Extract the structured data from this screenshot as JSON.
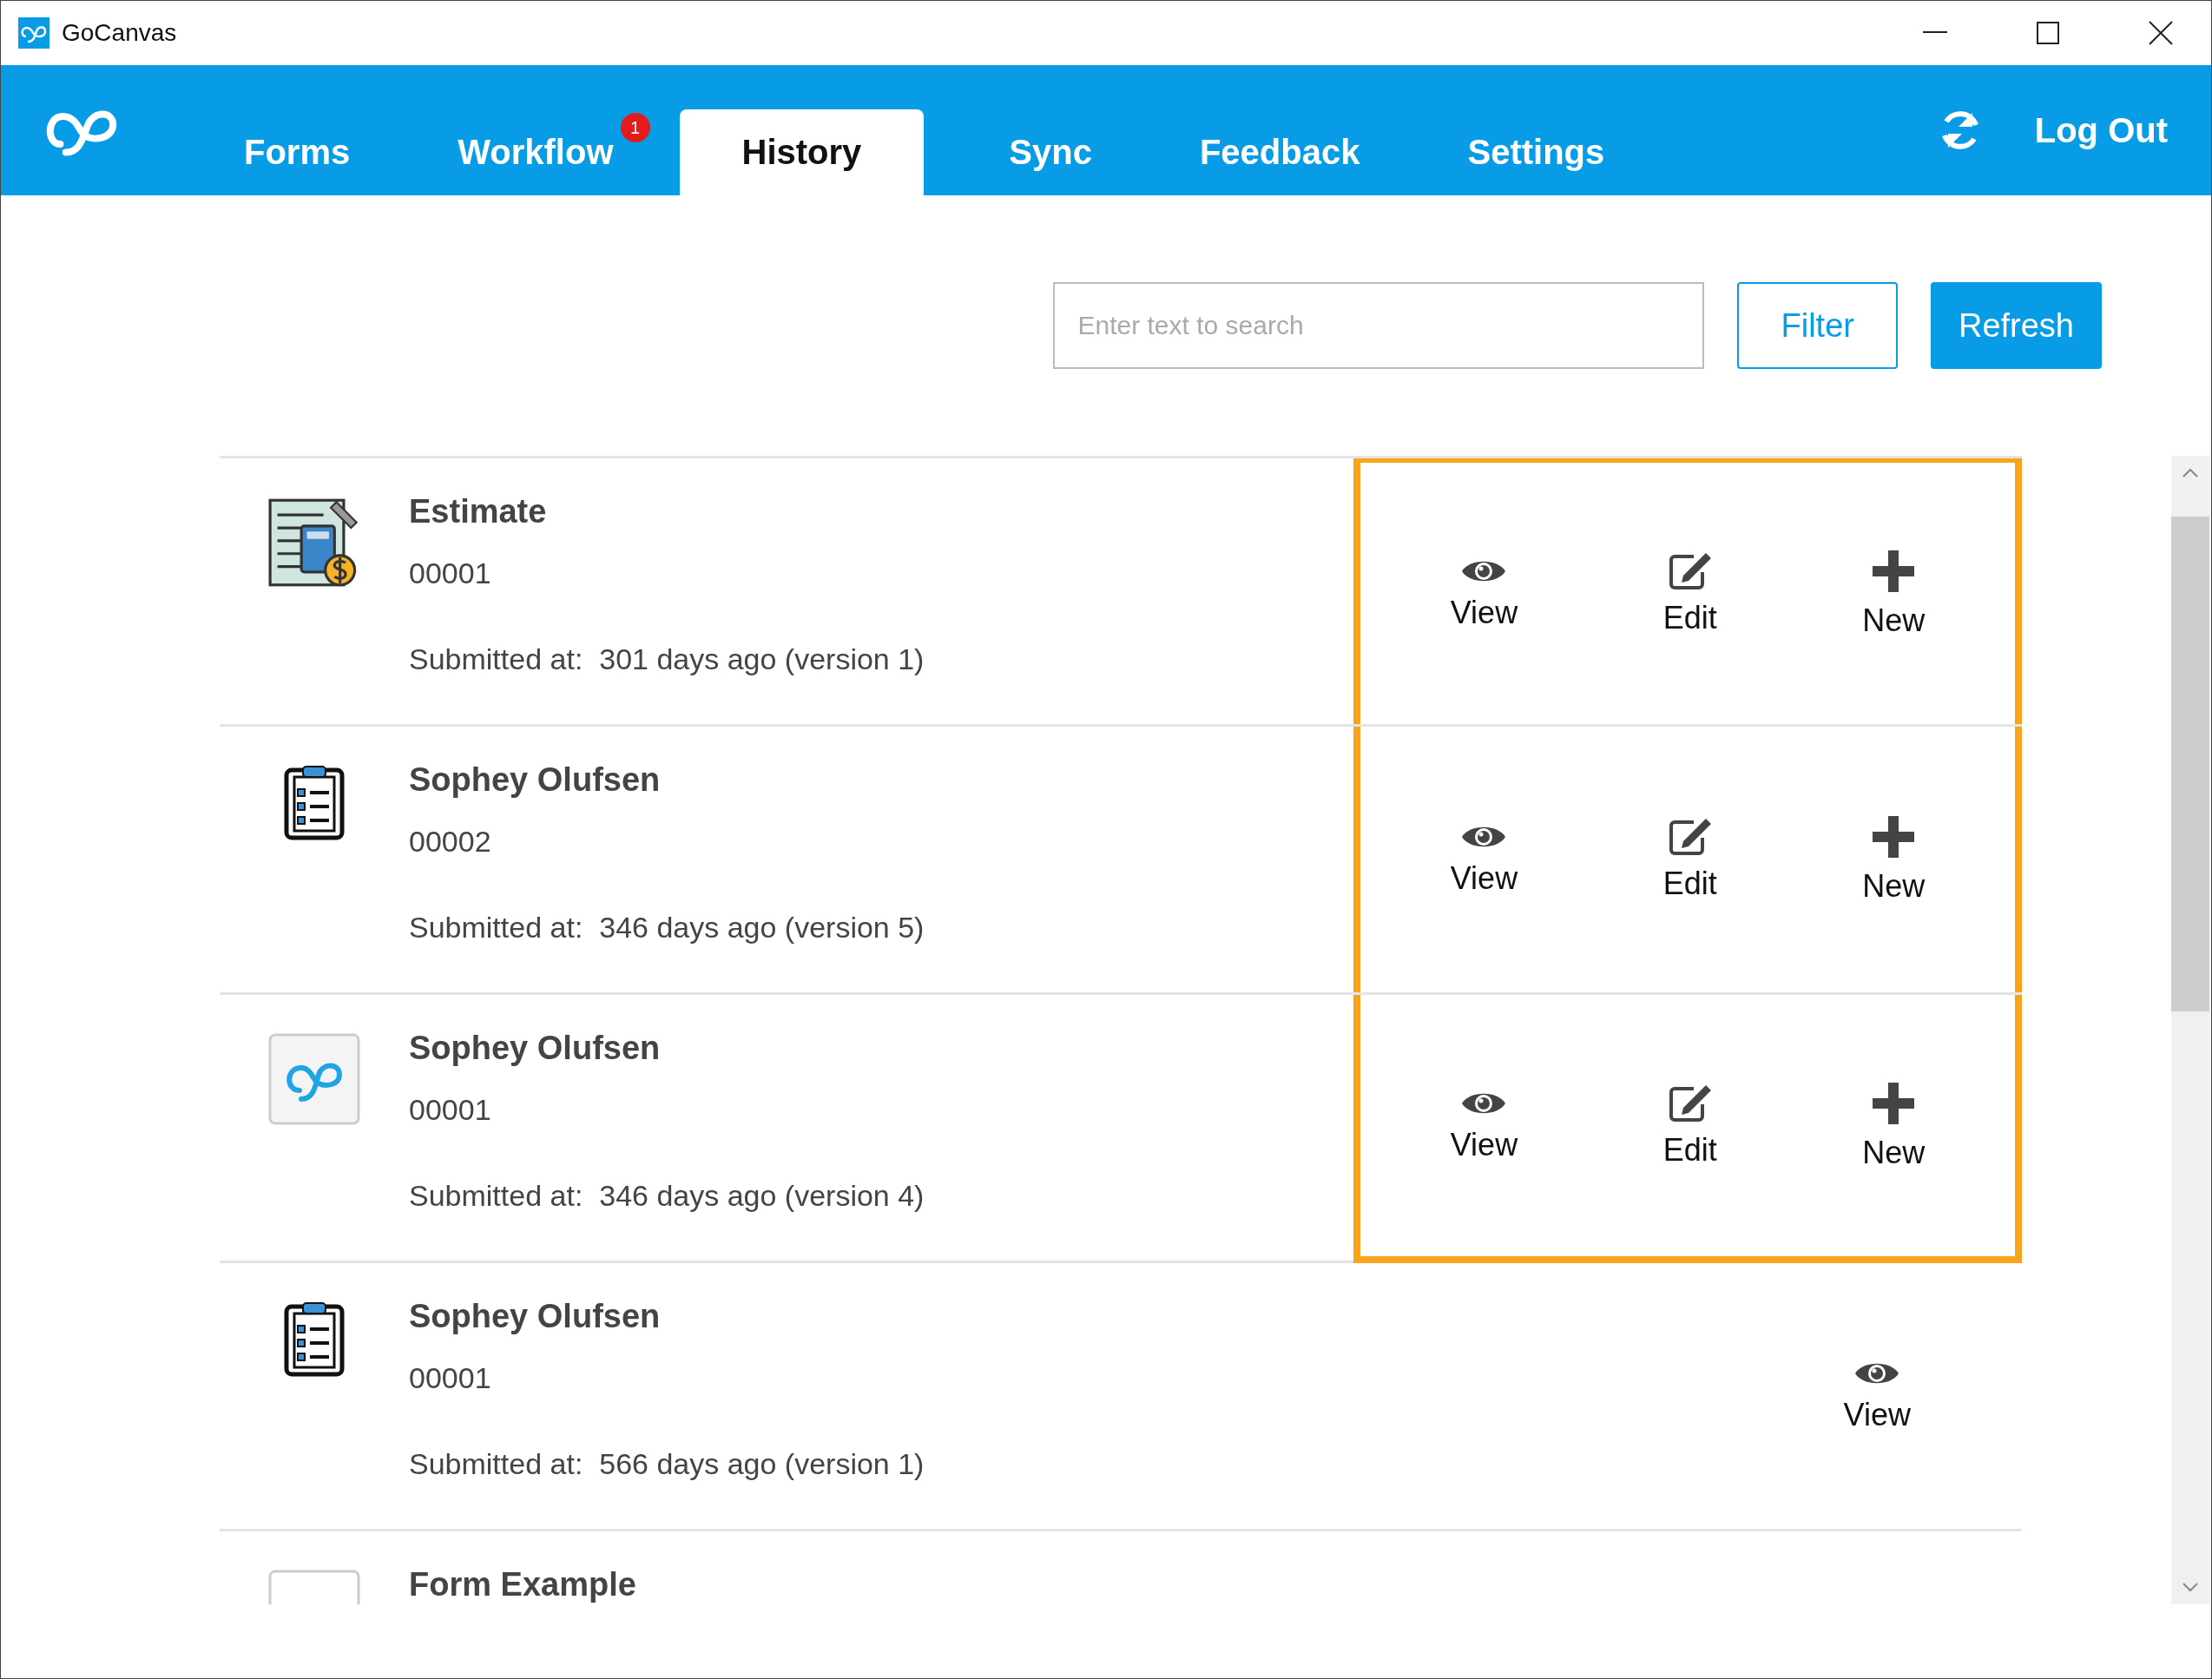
{
  "window": {
    "title": "GoCanvas"
  },
  "nav": {
    "tabs": [
      {
        "label": "Forms",
        "selected": false
      },
      {
        "label": "Workflow",
        "selected": false,
        "badge": "1"
      },
      {
        "label": "History",
        "selected": true
      },
      {
        "label": "Sync",
        "selected": false
      },
      {
        "label": "Feedback",
        "selected": false
      },
      {
        "label": "Settings",
        "selected": false
      }
    ],
    "logout": "Log Out"
  },
  "toolbar": {
    "search": {
      "placeholder": "Enter text to search"
    },
    "filter": "Filter",
    "refresh": "Refresh"
  },
  "history": [
    {
      "kind": "estimate",
      "title": "Estimate",
      "number": "00001",
      "submitted": "Submitted at:  301 days ago (version 1)",
      "highlighted": true,
      "actions": [
        {
          "kind": "view",
          "label": "View"
        },
        {
          "kind": "edit",
          "label": "Edit"
        },
        {
          "kind": "new",
          "label": "New"
        }
      ]
    },
    {
      "kind": "clipboard",
      "title": "Sophey Olufsen",
      "number": "00002",
      "submitted": "Submitted at:  346 days ago (version 5)",
      "highlighted": true,
      "actions": [
        {
          "kind": "view",
          "label": "View"
        },
        {
          "kind": "edit",
          "label": "Edit"
        },
        {
          "kind": "new",
          "label": "New"
        }
      ]
    },
    {
      "kind": "logo",
      "title": "Sophey Olufsen",
      "number": "00001",
      "submitted": "Submitted at:  346 days ago (version 4)",
      "highlighted": true,
      "actions": [
        {
          "kind": "view",
          "label": "View"
        },
        {
          "kind": "edit",
          "label": "Edit"
        },
        {
          "kind": "new",
          "label": "New"
        }
      ]
    },
    {
      "kind": "clipboard",
      "title": "Sophey Olufsen",
      "number": "00001",
      "submitted": "Submitted at:  566 days ago (version 1)",
      "highlighted": false,
      "actions": [
        {
          "kind": "view",
          "label": "View"
        }
      ]
    },
    {
      "kind": "blank",
      "title": "Form Example",
      "highlighted": false
    }
  ]
}
